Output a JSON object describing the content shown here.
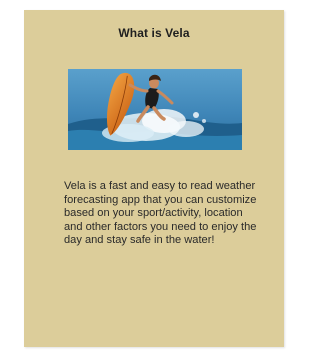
{
  "card": {
    "title": "What is Vela",
    "image": {
      "icon": "surfer-photo"
    },
    "description": "Vela is a fast and easy to read weather forecasting app that you can customize based on your sport/activity, location and other factors you need to enjoy the day and stay safe in the water!"
  },
  "colors": {
    "card_background": "#dccd9a",
    "text": "#2a2a2a",
    "sea": "#2e7aa8",
    "board": "#d9731c"
  }
}
